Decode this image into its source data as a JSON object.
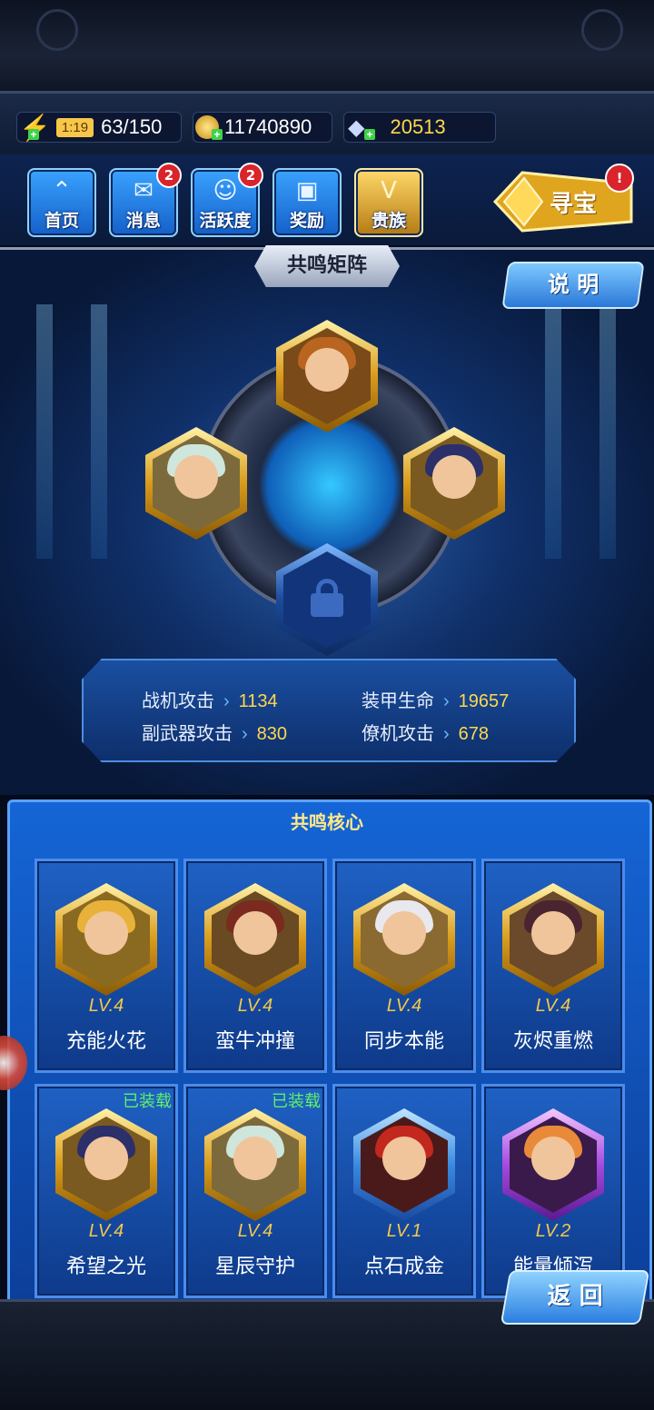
{
  "resources": {
    "energy_timer": "1:19",
    "energy": "63/150",
    "gold": "11740890",
    "diamonds": "20513"
  },
  "nav": {
    "home": "首页",
    "messages": "消息",
    "messages_badge": "2",
    "activity": "活跃度",
    "activity_badge": "2",
    "rewards": "奖励",
    "noble": "贵族",
    "treasure": "寻宝",
    "treasure_badge": "!"
  },
  "matrix": {
    "title": "共鸣矩阵",
    "explain_button": "说 明",
    "stats": [
      {
        "label": "战机攻击",
        "value": "1134"
      },
      {
        "label": "装甲生命",
        "value": "19657"
      },
      {
        "label": "副武器攻击",
        "value": "830"
      },
      {
        "label": "僚机攻击",
        "value": "678"
      }
    ]
  },
  "core": {
    "title": "共鸣核心",
    "cards": [
      {
        "level": "LV.4",
        "name": "充能火花",
        "equipped": ""
      },
      {
        "level": "LV.4",
        "name": "蛮牛冲撞",
        "equipped": ""
      },
      {
        "level": "LV.4",
        "name": "同步本能",
        "equipped": ""
      },
      {
        "level": "LV.4",
        "name": "灰烬重燃",
        "equipped": ""
      },
      {
        "level": "LV.4",
        "name": "希望之光",
        "equipped": "已装载"
      },
      {
        "level": "LV.4",
        "name": "星辰守护",
        "equipped": "已装载"
      },
      {
        "level": "LV.1",
        "name": "点石成金",
        "equipped": ""
      },
      {
        "level": "LV.2",
        "name": "能量倾泻",
        "equipped": ""
      }
    ]
  },
  "back_button": "返 回",
  "colors": {
    "gold_text": "#ffd84d",
    "equipped_green": "#5ff06a",
    "panel_blue": "#1565d6"
  }
}
